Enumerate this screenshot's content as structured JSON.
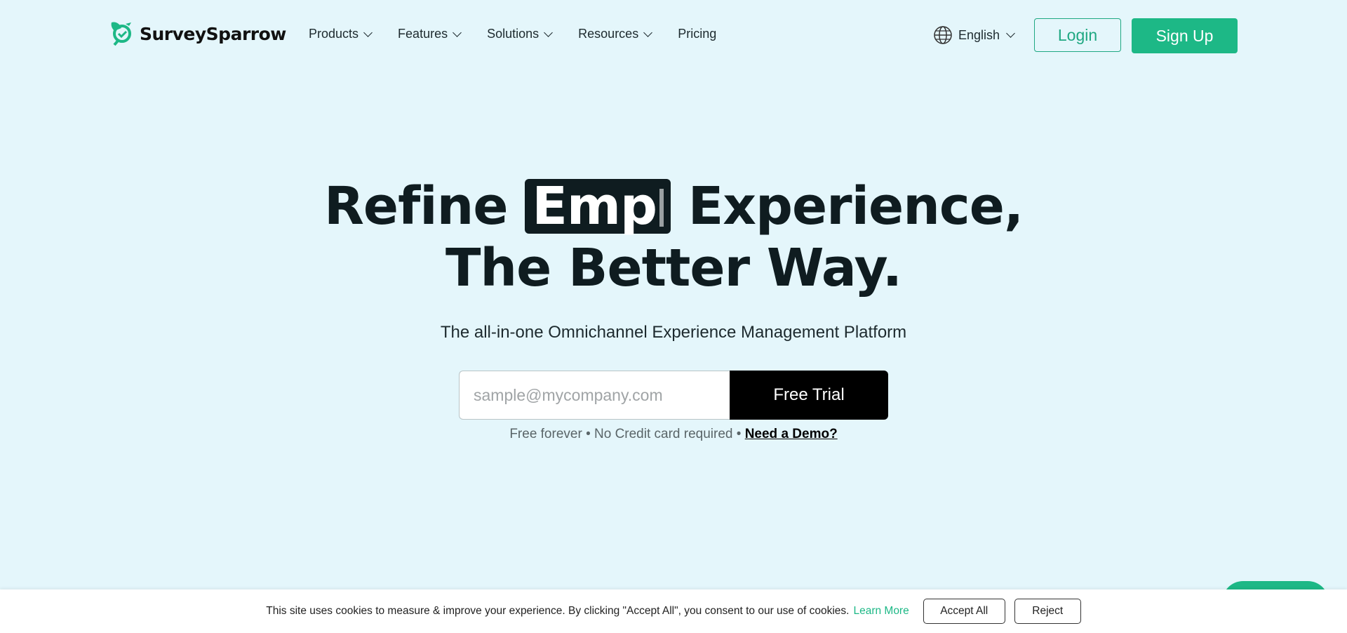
{
  "brand": {
    "name": "SurveySparrow",
    "accent": "#1db886"
  },
  "nav": {
    "menu": [
      {
        "label": "Products",
        "dropdown": true
      },
      {
        "label": "Features",
        "dropdown": true
      },
      {
        "label": "Solutions",
        "dropdown": true
      },
      {
        "label": "Resources",
        "dropdown": true
      },
      {
        "label": "Pricing",
        "dropdown": false
      }
    ],
    "language": "English",
    "login": "Login",
    "signup": "Sign Up"
  },
  "hero": {
    "title_before": "Refine ",
    "title_typed": "Emp",
    "title_after": " Experience,",
    "title_line2": "The Better Way.",
    "subtitle": "The all-in-one Omnichannel Experience Management Platform",
    "email_placeholder": "sample@mycompany.com",
    "cta": "Free Trial",
    "note": "Free forever • No Credit card required • ",
    "demo_link": "Need a Demo?"
  },
  "cookie": {
    "text": "This site uses cookies to measure & improve your experience. By clicking \"Accept All\", you consent to our use of cookies.",
    "learn_more": "Learn More",
    "accept": "Accept All",
    "reject": "Reject"
  }
}
